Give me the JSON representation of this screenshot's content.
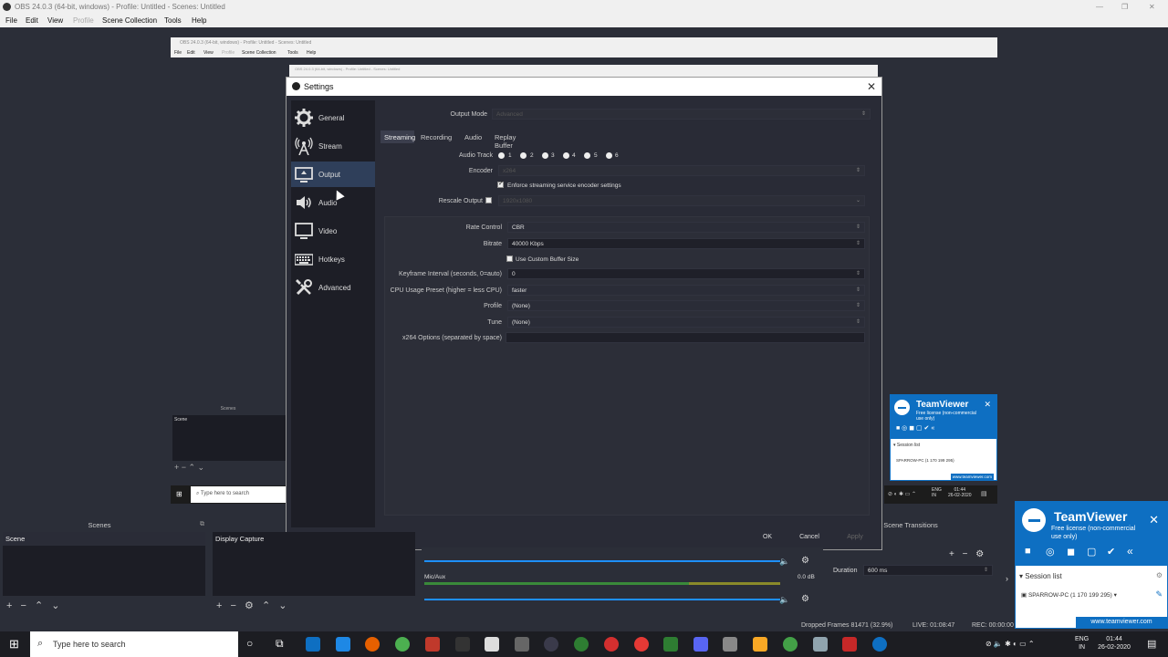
{
  "obs": {
    "title": "OBS 24.0.3 (64-bit, windows) - Profile: Untitled - Scenes: Untitled",
    "menu": [
      "File",
      "Edit",
      "View",
      "Profile",
      "Scene Collection",
      "Tools",
      "Help"
    ],
    "nested_title": "OBS 24.0.3 (64-bit, windows) - Profile: Untitled - Scenes: Untitled",
    "nested_scenes_title": "Scenes",
    "nested_scene_item": "Scene",
    "nested_search": "Type here to search"
  },
  "settings": {
    "title": "Settings",
    "nav": [
      "General",
      "Stream",
      "Output",
      "Audio",
      "Video",
      "Hotkeys",
      "Advanced"
    ],
    "active_nav": "Output",
    "output_mode_label": "Output Mode",
    "output_mode_value": "Advanced",
    "tabs": [
      "Streaming",
      "Recording",
      "Audio",
      "Replay Buffer"
    ],
    "audio_track_label": "Audio Track",
    "audio_tracks": [
      "1",
      "2",
      "3",
      "4",
      "5",
      "6"
    ],
    "encoder_label": "Encoder",
    "encoder_value": "x264",
    "enforce_label": "Enforce streaming service encoder settings",
    "rescale_label": "Rescale Output",
    "rescale_value": "1920x1080",
    "rate_control_label": "Rate Control",
    "rate_control_value": "CBR",
    "bitrate_label": "Bitrate",
    "bitrate_value": "40000 Kbps",
    "custom_buffer_label": "Use Custom Buffer Size",
    "keyframe_label": "Keyframe Interval (seconds, 0=auto)",
    "keyframe_value": "0",
    "cpu_preset_label": "CPU Usage Preset (higher = less CPU)",
    "cpu_preset_value": "faster",
    "profile_label": "Profile",
    "profile_value": "(None)",
    "tune_label": "Tune",
    "tune_value": "(None)",
    "x264_options_label": "x264 Options (separated by space)",
    "x264_options_value": "",
    "ok": "OK",
    "cancel": "Cancel",
    "apply": "Apply"
  },
  "docks": {
    "scenes_title": "Scenes",
    "scene_item": "Scene",
    "sources_item": "Display Capture",
    "mic_label": "Mic/Aux",
    "mic_db": "0.0 dB",
    "transitions_title": "Scene Transitions",
    "duration_label": "Duration",
    "duration_value": "600 ms"
  },
  "status": {
    "dropped": "Dropped Frames 81471 (32.9%)",
    "live": "LIVE: 01:08:47",
    "rec": "REC: 00:00:00"
  },
  "teamviewer": {
    "title": "TeamViewer",
    "license": "Free license (non-commercial use only)",
    "session_list": "Session list",
    "session_item": "SPARROW-PC (1 170 199 295)",
    "url": "www.teamviewer.com"
  },
  "taskbar": {
    "search": "Type here to search",
    "lang": "ENG",
    "region": "IN",
    "time": "01:44",
    "date": "26-02-2020",
    "nested_lang": "ENG",
    "nested_region": "IN",
    "nested_time": "01:44",
    "nested_date": "26-02-2020"
  }
}
